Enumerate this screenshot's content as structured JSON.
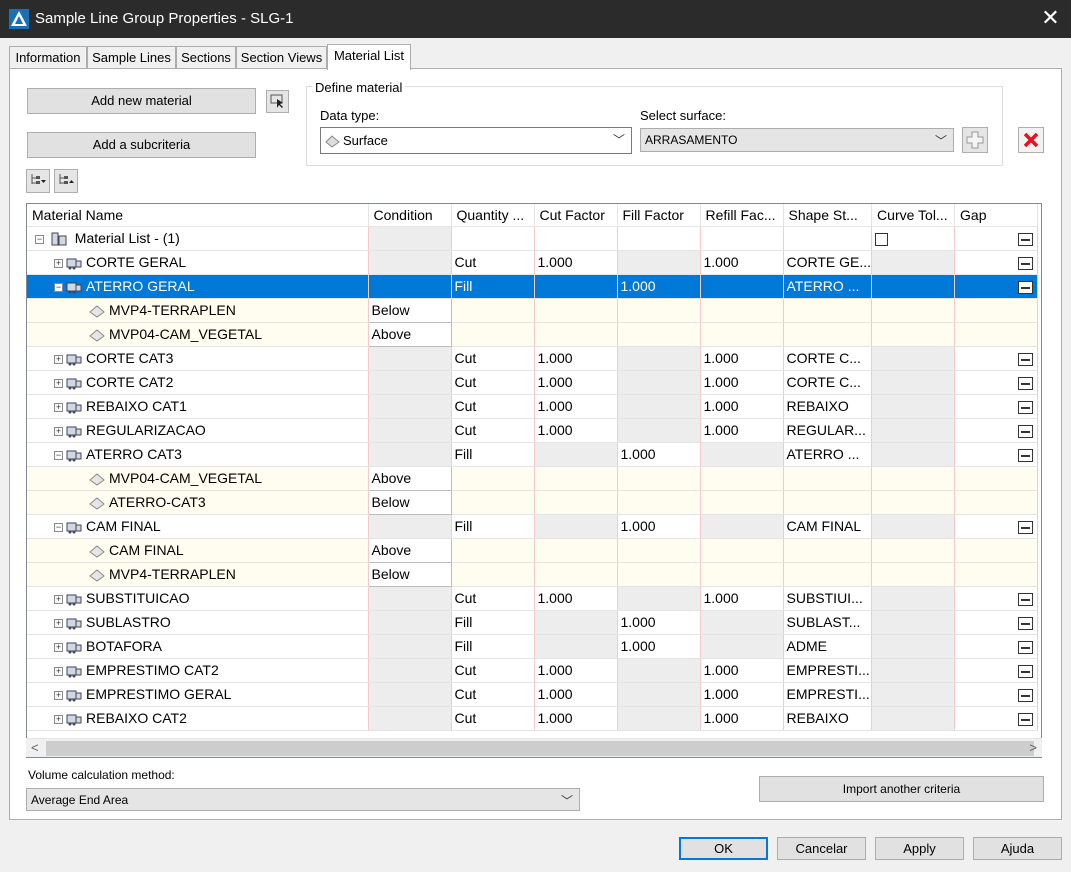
{
  "window": {
    "title": "Sample Line Group Properties - SLG-1",
    "close_glyph": "✕"
  },
  "tabs": [
    "Information",
    "Sample Lines",
    "Sections",
    "Section Views",
    "Material List"
  ],
  "buttons": {
    "add_new_material": "Add new material",
    "add_subcriteria": "Add a subcriteria",
    "import_criteria": "Import another criteria"
  },
  "define_material": {
    "legend": "Define material",
    "data_type_label": "Data type:",
    "data_type_value": "Surface",
    "select_surface_label": "Select surface:",
    "select_surface_value": "ARRASAMENTO"
  },
  "grid": {
    "columns": [
      "Material Name",
      "Condition",
      "Quantity ...",
      "Cut Factor",
      "Fill Factor",
      "Refill Fac...",
      "Shape St...",
      "Curve Tol...",
      "Gap"
    ],
    "root": "Material List - (1)",
    "rows": [
      {
        "name": "CORTE GERAL",
        "qty": "Cut",
        "cut": "1.000",
        "fill": "",
        "refill": "1.000",
        "shape": "CORTE GE...",
        "expanded": false
      },
      {
        "name": "ATERRO GERAL",
        "qty": "Fill",
        "cut": "",
        "fill": "1.000",
        "refill": "",
        "shape": "ATERRO ...",
        "expanded": true,
        "selected": true,
        "subs": [
          {
            "name": "MVP4-TERRAPLEN",
            "cond": "Below"
          },
          {
            "name": "MVP04-CAM_VEGETAL",
            "cond": "Above"
          }
        ]
      },
      {
        "name": "CORTE CAT3",
        "qty": "Cut",
        "cut": "1.000",
        "fill": "",
        "refill": "1.000",
        "shape": "CORTE C...",
        "expanded": false
      },
      {
        "name": "CORTE CAT2",
        "qty": "Cut",
        "cut": "1.000",
        "fill": "",
        "refill": "1.000",
        "shape": "CORTE C...",
        "expanded": false
      },
      {
        "name": "REBAIXO CAT1",
        "qty": "Cut",
        "cut": "1.000",
        "fill": "",
        "refill": "1.000",
        "shape": "REBAIXO",
        "expanded": false
      },
      {
        "name": "REGULARIZACAO",
        "qty": "Cut",
        "cut": "1.000",
        "fill": "",
        "refill": "1.000",
        "shape": "REGULAR...",
        "expanded": false
      },
      {
        "name": "ATERRO CAT3",
        "qty": "Fill",
        "cut": "",
        "fill": "1.000",
        "refill": "",
        "shape": "ATERRO ...",
        "expanded": true,
        "subs": [
          {
            "name": "MVP04-CAM_VEGETAL",
            "cond": "Above"
          },
          {
            "name": "ATERRO-CAT3",
            "cond": "Below"
          }
        ]
      },
      {
        "name": "CAM FINAL",
        "qty": "Fill",
        "cut": "",
        "fill": "1.000",
        "refill": "",
        "shape": "CAM FINAL",
        "expanded": true,
        "subs": [
          {
            "name": "CAM FINAL",
            "cond": "Above"
          },
          {
            "name": "MVP4-TERRAPLEN",
            "cond": "Below"
          }
        ]
      },
      {
        "name": "SUBSTITUICAO",
        "qty": "Cut",
        "cut": "1.000",
        "fill": "",
        "refill": "1.000",
        "shape": "SUBSTIUI...",
        "expanded": false
      },
      {
        "name": "SUBLASTRO",
        "qty": "Fill",
        "cut": "",
        "fill": "1.000",
        "refill": "",
        "shape": "SUBLAST...",
        "expanded": false
      },
      {
        "name": "BOTAFORA",
        "qty": "Fill",
        "cut": "",
        "fill": "1.000",
        "refill": "",
        "shape": "ADME",
        "expanded": false
      },
      {
        "name": "EMPRESTIMO CAT2",
        "qty": "Cut",
        "cut": "1.000",
        "fill": "",
        "refill": "1.000",
        "shape": "EMPRESTI...",
        "expanded": false
      },
      {
        "name": "EMPRESTIMO GERAL",
        "qty": "Cut",
        "cut": "1.000",
        "fill": "",
        "refill": "1.000",
        "shape": "EMPRESTI...",
        "expanded": false
      },
      {
        "name": "REBAIXO CAT2",
        "qty": "Cut",
        "cut": "1.000",
        "fill": "",
        "refill": "1.000",
        "shape": "REBAIXO",
        "expanded": false
      }
    ]
  },
  "volume": {
    "label": "Volume calculation method:",
    "value": "Average End Area"
  },
  "footer": {
    "ok": "OK",
    "cancel": "Cancelar",
    "apply": "Apply",
    "help": "Ajuda"
  },
  "colors": {
    "selection": "#0078d7",
    "titlebar": "#2b2b2b",
    "delete_red": "#e81123"
  }
}
